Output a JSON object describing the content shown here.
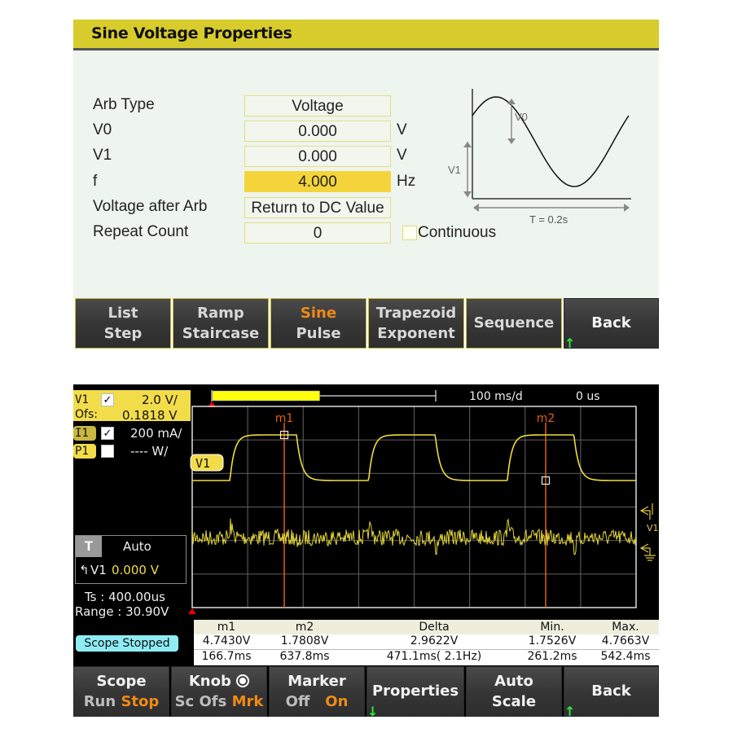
{
  "top": {
    "title": "Sine Voltage Properties",
    "properties": [
      {
        "label": "Arb Type",
        "value": "Voltage",
        "unit": "",
        "active": false
      },
      {
        "label": "V0",
        "value": "0.000",
        "unit": "V",
        "active": false
      },
      {
        "label": "V1",
        "value": "0.000",
        "unit": "V",
        "active": false
      },
      {
        "label": "f",
        "value": "4.000",
        "unit": "Hz",
        "active": true
      },
      {
        "label": "Voltage after Arb",
        "value": "Return to DC Value",
        "unit": "",
        "active": false
      },
      {
        "label": "Repeat Count",
        "value": "0",
        "unit": "",
        "active": false
      }
    ],
    "continuous": {
      "label": "Continuous",
      "checked": false
    },
    "diagram": {
      "v0_label": "V0",
      "v1_label": "V1",
      "period_label": "T = 0.2s"
    },
    "softkeys": [
      {
        "line1": "List",
        "line2": "Step",
        "highlight": ""
      },
      {
        "line1": "Ramp",
        "line2": "Staircase",
        "highlight": ""
      },
      {
        "line1": "Sine",
        "line2": "Pulse",
        "highlight": "line1"
      },
      {
        "line1": "Trapezoid",
        "line2": "Exponent",
        "highlight": ""
      },
      {
        "line1": "Sequence",
        "line2": "",
        "highlight": ""
      },
      {
        "line1": "Back",
        "line2": "",
        "highlight": "",
        "arrow": "up"
      }
    ]
  },
  "scope": {
    "channels": {
      "v1": {
        "tag": "V1",
        "checked": true,
        "scale": "2.0 V/",
        "offset_label": "Ofs:",
        "offset": "0.1818 V"
      },
      "i1": {
        "tag": "I1",
        "checked": true,
        "scale": "200 mA/"
      },
      "p1": {
        "tag": "P1",
        "checked": false,
        "scale": "---- W/"
      }
    },
    "trace_label": "V1",
    "timebase": "100 ms/d",
    "delay": "0 us",
    "record_fill": 0.48,
    "trigger": {
      "label": "T",
      "mode": "Auto",
      "source": "V1",
      "level": "0.000 V"
    },
    "sample_time": "Ts :  400.00us",
    "range": "Range :  30.90V",
    "status": "Scope Stopped",
    "markers": {
      "m1_label": "m1",
      "m2_label": "m2",
      "m1_time_ms": 166.7,
      "m2_time_ms": 637.8
    },
    "voltage_trace": {
      "high_v": 4.7663,
      "low_v": 1.7526,
      "period_ms": 250,
      "duty": 0.48
    },
    "readout": {
      "headers": [
        "m1",
        "m2",
        "Delta",
        "Min.",
        "Max."
      ],
      "voltage": [
        "4.7430V",
        "1.7808V",
        "2.9622V",
        "1.7526V",
        "4.7663V"
      ],
      "time": [
        "166.7ms",
        "637.8ms",
        "471.1ms( 2.1Hz)",
        "261.2ms",
        "542.4ms"
      ]
    },
    "softkeys": {
      "scope": {
        "title": "Scope",
        "opt1": "Run",
        "opt2": "Stop",
        "selected": "Stop"
      },
      "knob": {
        "title": "Knob",
        "opt1": "Sc",
        "opt2": "Ofs",
        "opt3": "Mrk",
        "selected": "Mrk"
      },
      "marker": {
        "title": "Marker",
        "opt1": "Off",
        "opt2": "On",
        "selected": "On"
      },
      "properties": {
        "title": "Properties"
      },
      "autoscale": {
        "line1": "Auto",
        "line2": "Scale"
      },
      "back": {
        "title": "Back"
      }
    }
  },
  "colors": {
    "header_yellow": "#d7cc2c",
    "active_field": "#f4d43a",
    "trace_yellow": "#f0dc3a",
    "current_trace": "#e2d43a",
    "marker_orange": "#e0600f",
    "softkey_highlight": "#f08a18",
    "status_cyan": "#8eecf4",
    "arrow_green": "#2ee83a"
  }
}
